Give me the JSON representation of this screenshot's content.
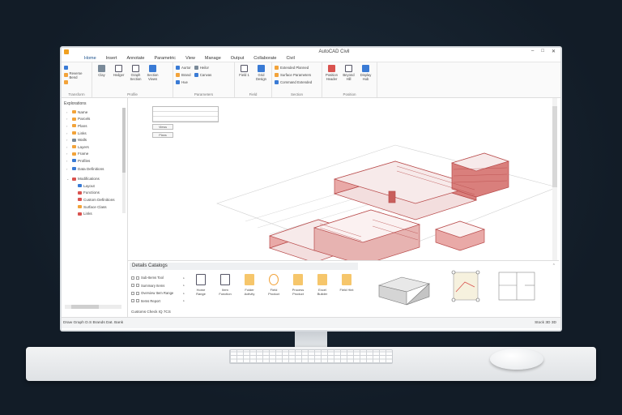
{
  "window": {
    "title": "AutoCAD Civil",
    "controls": [
      "–",
      "□",
      "✕"
    ]
  },
  "menu": {
    "tabs": [
      "Home",
      "Insert",
      "Annotate",
      "Parametric",
      "View",
      "Manage",
      "Output",
      "Collaborate",
      "Civil"
    ]
  },
  "ribbon": {
    "groups": [
      {
        "name": "Transform",
        "buttons": [
          "Reverse Bend"
        ]
      },
      {
        "name": "Profile",
        "buttons": [
          "Clay",
          "Hedger",
          "Graph Section",
          "Section Views"
        ]
      },
      {
        "name": "Parameters",
        "small_buttons": [
          "Aurtor",
          "Brand",
          "Hue",
          "Heilor",
          "Canvas"
        ]
      },
      {
        "name": "Field",
        "buttons": [
          "Field 1",
          "Grid Design"
        ]
      },
      {
        "name": "Section",
        "small_buttons": [
          "Extended Planned",
          "Surface Parameters",
          "Command Extended"
        ]
      },
      {
        "name": "Position",
        "buttons": [
          "Position Header",
          "Beyond Hill",
          "Display Hub"
        ]
      }
    ]
  },
  "left_panel": {
    "title": "Explorations",
    "items": [
      {
        "label": "Name",
        "color": "#f2a33a"
      },
      {
        "label": "Parcels",
        "color": "#f2a33a"
      },
      {
        "label": "Plans",
        "color": "#f2a33a"
      },
      {
        "label": "Links",
        "color": "#f2a33a"
      },
      {
        "label": "Walls",
        "color": "#7a8a99"
      },
      {
        "label": "Layers",
        "color": "#f2a33a"
      },
      {
        "label": "Frame",
        "color": "#f2a33a"
      },
      {
        "label": "Profiles",
        "color": "#3a7bd5"
      }
    ],
    "section2_title": "Data Definitions",
    "section3_title": "Modifications",
    "sub_items": [
      {
        "label": "Layout",
        "color": "#3a7bd5"
      },
      {
        "label": "Functions",
        "color": "#d9534f"
      },
      {
        "label": "Custom Definitions",
        "color": "#d9534f"
      },
      {
        "label": "Surface Class",
        "color": "#f2a33a"
      },
      {
        "label": "Links",
        "color": "#d9534f"
      }
    ]
  },
  "viewport": {
    "table_rows": [
      "",
      "",
      ""
    ],
    "buttons": [
      "Views",
      "Plans"
    ]
  },
  "bottom_panel": {
    "title": "Details Catalogs",
    "list": [
      "Sub-Items Tool",
      "Summary Items",
      "Overview Item Range",
      "Items Report"
    ],
    "icons": [
      {
        "label": "Home Range",
        "color": "#5d6d7e"
      },
      {
        "label": "Item Function",
        "color": "#7a8a99"
      },
      {
        "label": "Folder Activity",
        "color": "#f2a33a"
      },
      {
        "label": "Field Product",
        "color": "#f2a33a"
      },
      {
        "label": "Process Product",
        "color": "#f2a33a"
      },
      {
        "label": "Excel Builder",
        "color": "#f2a33a"
      },
      {
        "label": "Field Hint",
        "color": "#f2a33a"
      }
    ],
    "caption": "Customs Check IQ 7CS"
  },
  "statusbar": {
    "left": "Draw Graph  D.S  Brands  Dat. Bank",
    "right": "Stock 3D 3D"
  }
}
